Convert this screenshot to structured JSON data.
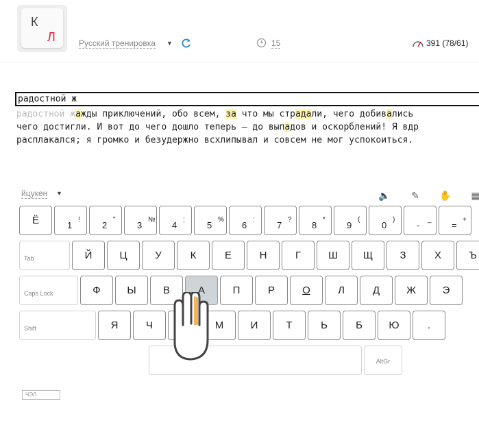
{
  "header": {
    "logo_k": "К",
    "logo_l": "Л",
    "language": "Русский тренировка",
    "time": "15",
    "speed": "391 (78/61)",
    "colors": {
      "accent_red": "#dd2233",
      "link_gray": "#888888"
    }
  },
  "input": {
    "typed": "радостной ж"
  },
  "text": {
    "line1_typed": "радостной ж",
    "line1_rest_a": "",
    "line1_hl_a": "а",
    "line1_rest_b": "жды приключений, обо всем, ",
    "line1_hl_b": "за",
    "line1_rest_c": " что мы стр",
    "line1_hl_c": "ада",
    "line1_rest_d": "ли, чего добив",
    "line1_hl_d": "а",
    "line1_rest_e": "лись",
    "line2": "чего достигли. И вот до чего дошло теперь – до вып",
    "line2_hl": "а",
    "line2_rest": "дов и оскорблений! Я вдр",
    "line3": "расплакался; я громко и безудержно всхлипывал и совсем не мог успокоиться. "
  },
  "keyboard": {
    "layout": "йцукен",
    "icons": [
      "sound-off-icon",
      "color-icon",
      "hands-icon",
      "grid-icon"
    ],
    "row1": [
      {
        "main": "Ё"
      },
      {
        "main": "1",
        "shift": "!"
      },
      {
        "main": "2",
        "shift": "\""
      },
      {
        "main": "3",
        "shift": "№"
      },
      {
        "main": "4",
        "shift": ";"
      },
      {
        "main": "5",
        "shift": "%"
      },
      {
        "main": "6",
        "shift": ":"
      },
      {
        "main": "7",
        "shift": "?"
      },
      {
        "main": "8",
        "shift": "*"
      },
      {
        "main": "9",
        "shift": "("
      },
      {
        "main": "0",
        "shift": ")"
      },
      {
        "main": "-",
        "shift": "_"
      },
      {
        "main": "=",
        "shift": "+"
      }
    ],
    "row2_mod": "Tab",
    "row2": [
      "Й",
      "Ц",
      "У",
      "К",
      "Е",
      "Н",
      "Г",
      "Ш",
      "Щ",
      "З",
      "Х",
      "Ъ"
    ],
    "row3_mod": "Caps Lock",
    "row3": [
      "Ф",
      "Ы",
      "В",
      "А",
      "П",
      "Р",
      "О",
      "Л",
      "Д",
      "Ж",
      "Э"
    ],
    "row4_mod": "Shift",
    "row4": [
      "Я",
      "Ч",
      "С",
      "М",
      "И",
      "Т",
      "Ь",
      "Б",
      "Ю",
      "."
    ],
    "altgr": "AltGr",
    "footer": "ЧЭЛ"
  }
}
